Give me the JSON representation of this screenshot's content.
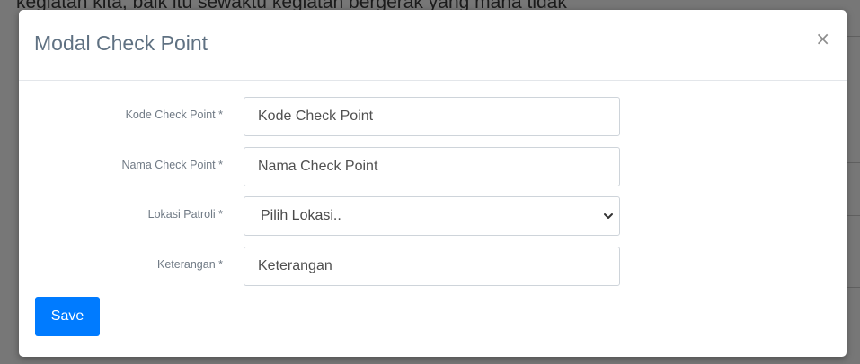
{
  "background": {
    "top_text": "kegiatan kita, baik itu sewaktu kegiatan bergerak yang mana tidak"
  },
  "modal": {
    "title": "Modal Check Point",
    "close_label": "×",
    "fields": [
      {
        "label": "Kode Check Point *",
        "placeholder": "Kode Check Point",
        "type": "text"
      },
      {
        "label": "Nama Check Point *",
        "placeholder": "Nama Check Point",
        "type": "text"
      },
      {
        "label": "Lokasi Patroli *",
        "selected": "Pilih Lokasi..",
        "type": "select"
      },
      {
        "label": "Keterangan *",
        "placeholder": "Keterangan",
        "type": "text"
      }
    ],
    "save_label": "Save"
  },
  "colors": {
    "primary": "#007bff",
    "title": "#5f7182",
    "label": "#707a85",
    "border": "#ced4da"
  }
}
